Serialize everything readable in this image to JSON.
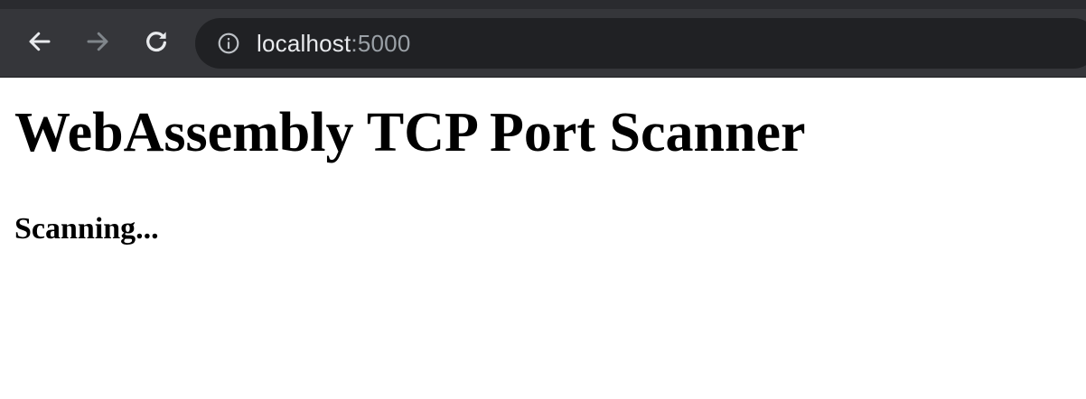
{
  "browser": {
    "address": {
      "host": "localhost",
      "port": ":5000"
    },
    "icons": {
      "back": "arrow-left",
      "forward": "arrow-right",
      "reload": "refresh",
      "site_info": "info-circle"
    },
    "colors": {
      "toolbar": "#35363a",
      "omnibox": "#202124",
      "icon_active": "#e8eaed",
      "icon_disabled": "#80868b"
    }
  },
  "page": {
    "title": "WebAssembly TCP Port Scanner",
    "status": "Scanning..."
  }
}
